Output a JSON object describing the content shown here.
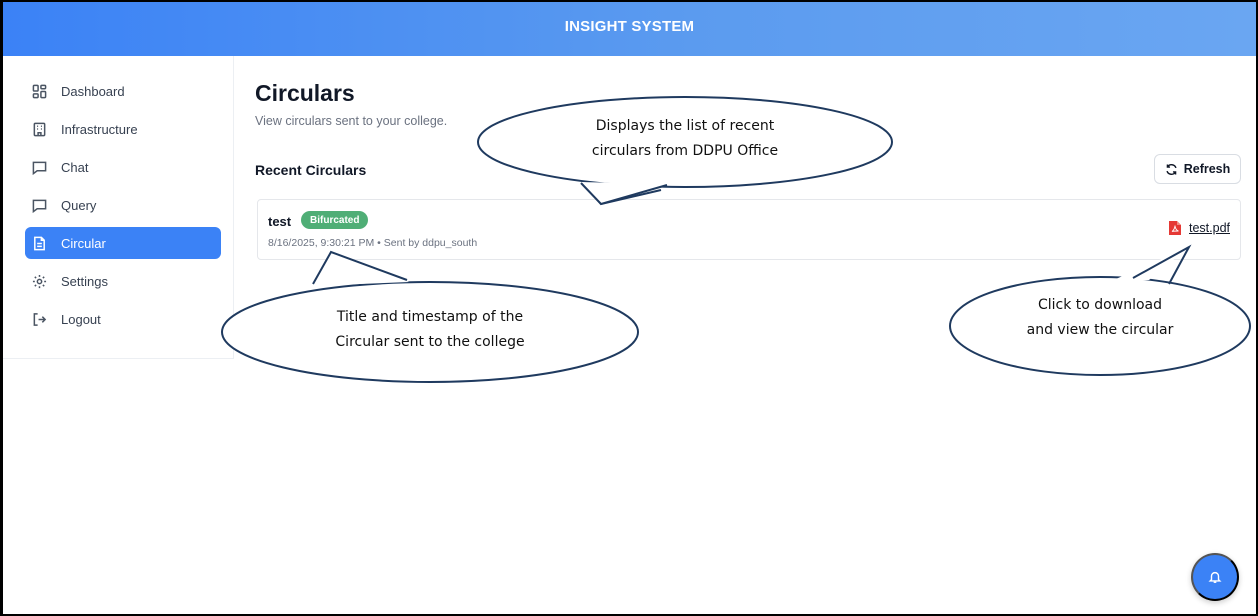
{
  "app": {
    "title": "INSIGHT SYSTEM"
  },
  "sidebar": {
    "items": [
      {
        "label": "Dashboard",
        "icon": "dashboard-icon",
        "active": false
      },
      {
        "label": "Infrastructure",
        "icon": "building-icon",
        "active": false
      },
      {
        "label": "Chat",
        "icon": "chat-icon",
        "active": false
      },
      {
        "label": "Query",
        "icon": "query-icon",
        "active": false
      },
      {
        "label": "Circular",
        "icon": "document-icon",
        "active": true
      },
      {
        "label": "Settings",
        "icon": "gear-icon",
        "active": false
      },
      {
        "label": "Logout",
        "icon": "logout-icon",
        "active": false
      }
    ]
  },
  "main": {
    "title": "Circulars",
    "subtitle": "View circulars sent to your college.",
    "section_title": "Recent Circulars",
    "refresh_label": "Refresh",
    "circulars": [
      {
        "title": "test",
        "badge": "Bifurcated",
        "meta": "8/16/2025, 9:30:21 PM • Sent by ddpu_south",
        "file": "test.pdf"
      }
    ]
  },
  "annotations": {
    "list": [
      "Displays the list of recent",
      "circulars from DDPU Office"
    ],
    "title_timestamp": [
      "Title and timestamp of the",
      "Circular sent to the college"
    ],
    "download": [
      "Click to download",
      "and view the circular"
    ]
  },
  "colors": {
    "accent": "#3b82f6",
    "badge": "#4fae76",
    "pdf": "#e53935",
    "callout_stroke": "#1f3a5f"
  },
  "fab": {
    "icon": "bell-icon"
  }
}
